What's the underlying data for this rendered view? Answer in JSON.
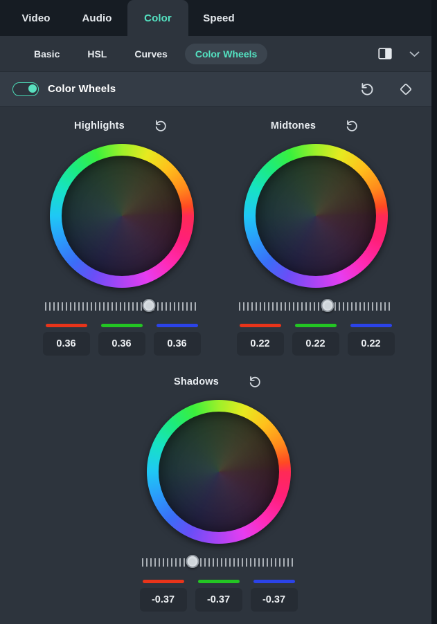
{
  "top_tabs": [
    {
      "label": "Video",
      "active": false
    },
    {
      "label": "Audio",
      "active": false
    },
    {
      "label": "Color",
      "active": true
    },
    {
      "label": "Speed",
      "active": false
    }
  ],
  "sub_tabs": [
    {
      "label": "Basic",
      "active": false
    },
    {
      "label": "HSL",
      "active": false
    },
    {
      "label": "Curves",
      "active": false
    },
    {
      "label": "Color Wheels",
      "active": true
    }
  ],
  "sub_tab_icons": [
    {
      "name": "compare-view-icon"
    },
    {
      "name": "chevron-down-icon"
    }
  ],
  "module": {
    "title": "Color Wheels",
    "toggle_on": true,
    "icons": [
      {
        "name": "reset-icon"
      },
      {
        "name": "keyframe-icon"
      }
    ]
  },
  "colors": {
    "accent": "#54e3c2",
    "toggle_on": "#5ae0bf",
    "panel_bg": "#2d343d",
    "topbar_bg": "#161c23",
    "header_bg": "#343c46",
    "value_box_bg": "#262c34",
    "red": "#e8341a",
    "green": "#23c523",
    "blue": "#2b43e8",
    "text": "#e6eaee"
  },
  "wheels": [
    {
      "id": "highlights",
      "label": "Highlights",
      "reset_icon": "reset-icon",
      "slider_percent": 68,
      "channels": [
        {
          "name": "red",
          "color": "#e8341a",
          "value": "0.36"
        },
        {
          "name": "green",
          "color": "#23c523",
          "value": "0.36"
        },
        {
          "name": "blue",
          "color": "#2b43e8",
          "value": "0.36"
        }
      ]
    },
    {
      "id": "midtones",
      "label": "Midtones",
      "reset_icon": "reset-icon",
      "slider_percent": 58,
      "channels": [
        {
          "name": "red",
          "color": "#e8341a",
          "value": "0.22"
        },
        {
          "name": "green",
          "color": "#23c523",
          "value": "0.22"
        },
        {
          "name": "blue",
          "color": "#2b43e8",
          "value": "0.22"
        }
      ]
    },
    {
      "id": "shadows",
      "label": "Shadows",
      "reset_icon": "reset-icon",
      "slider_percent": 33,
      "channels": [
        {
          "name": "red",
          "color": "#e8341a",
          "value": "-0.37"
        },
        {
          "name": "green",
          "color": "#23c523",
          "value": "-0.37"
        },
        {
          "name": "blue",
          "color": "#2b43e8",
          "value": "-0.37"
        }
      ]
    }
  ]
}
